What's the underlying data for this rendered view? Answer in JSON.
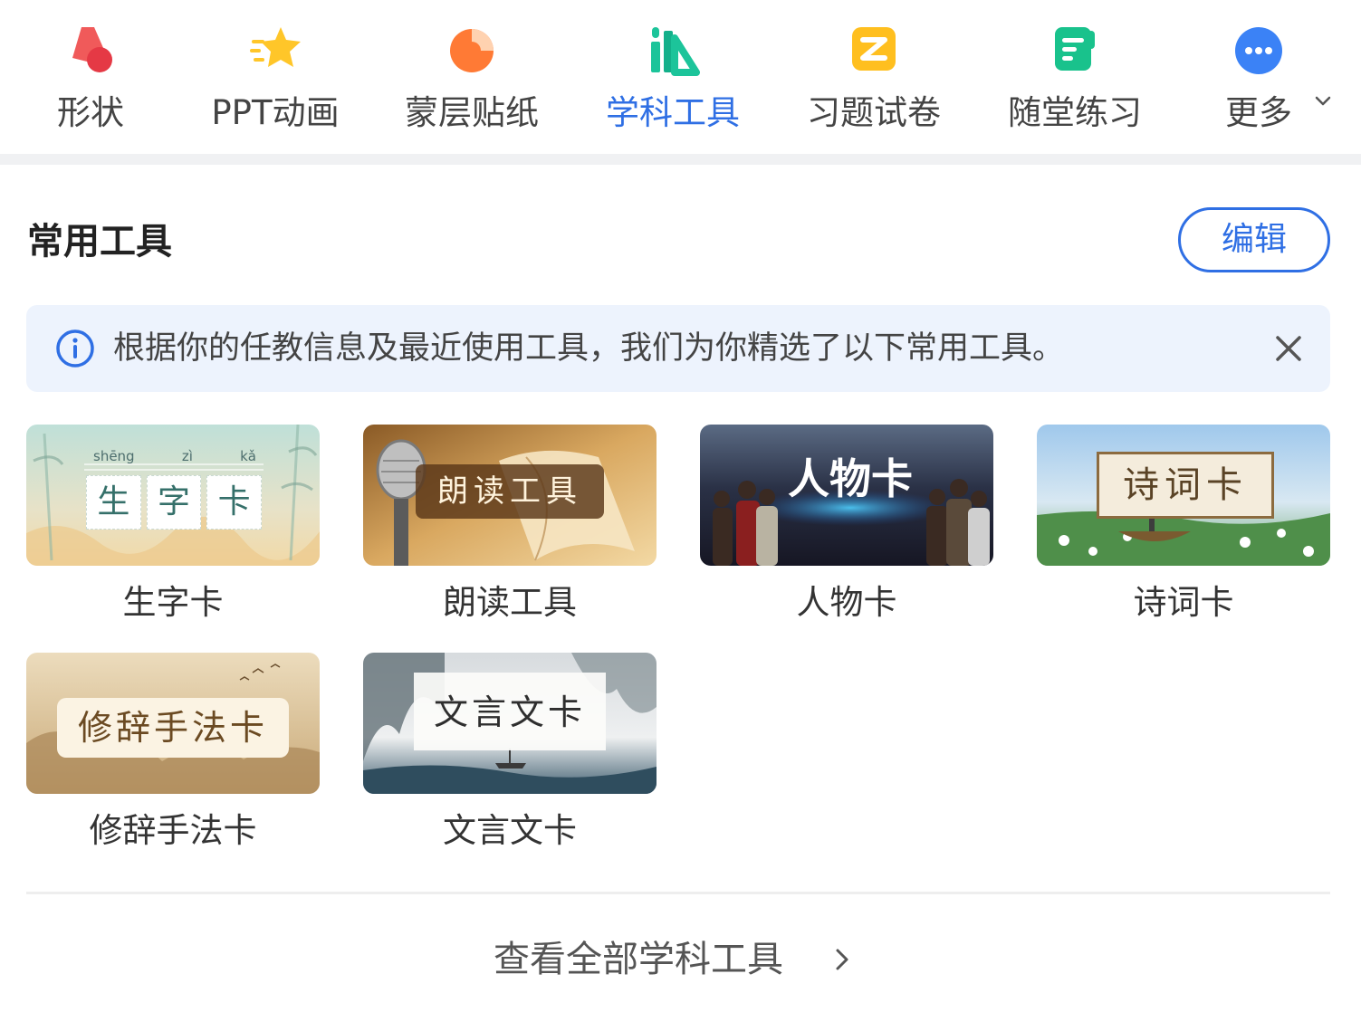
{
  "toolbar": {
    "items": [
      {
        "label": "形状"
      },
      {
        "label": "PPT动画"
      },
      {
        "label": "蒙层贴纸"
      },
      {
        "label": "学科工具"
      },
      {
        "label": "习题试卷"
      },
      {
        "label": "随堂练习"
      },
      {
        "label": "更多"
      }
    ],
    "active": "学科工具"
  },
  "section": {
    "title": "常用工具",
    "edit_label": "编辑"
  },
  "banner": {
    "message": "根据你的任教信息及最近使用工具，我们为你精选了以下常用工具。"
  },
  "cards": [
    {
      "label": "生字卡",
      "thumb": {
        "pinyin": [
          "shēng",
          "zì",
          "kǎ"
        ],
        "chars": [
          "生",
          "字",
          "卡"
        ]
      }
    },
    {
      "label": "朗读工具",
      "thumb": {
        "title": "朗读工具"
      }
    },
    {
      "label": "人物卡",
      "thumb": {
        "title": "人物卡"
      }
    },
    {
      "label": "诗词卡",
      "thumb": {
        "title": "诗词卡"
      }
    },
    {
      "label": "修辞手法卡",
      "thumb": {
        "title": "修辞手法卡"
      }
    },
    {
      "label": "文言文卡",
      "thumb": {
        "title": "文言文卡"
      }
    }
  ],
  "footer": {
    "view_all": "查看全部学科工具"
  },
  "colors": {
    "accent": "#2f6fe4",
    "banner_bg": "#edf3fd",
    "text": "#333333"
  },
  "icons": [
    "shape-icon",
    "ppt-animation-icon",
    "mask-sticker-icon",
    "subject-tools-icon",
    "exercise-paper-icon",
    "class-practice-icon",
    "more-icon",
    "info-icon",
    "close-icon",
    "chevron-right-icon"
  ]
}
